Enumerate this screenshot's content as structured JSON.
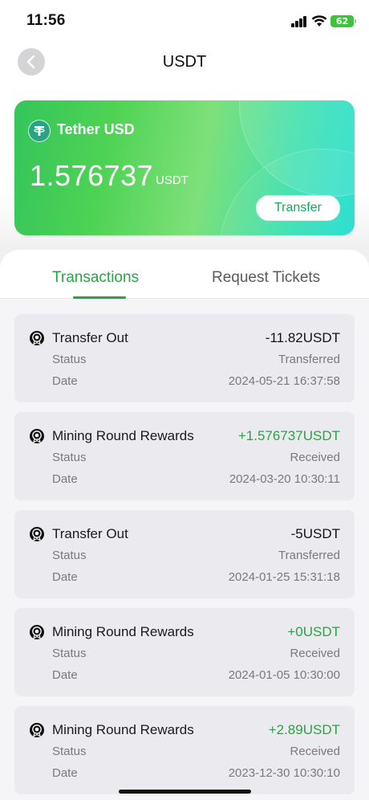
{
  "status_bar": {
    "time": "11:56",
    "battery": "62"
  },
  "header": {
    "title": "USDT"
  },
  "card": {
    "name": "Tether USD",
    "balance": "1.576737",
    "unit": "USDT",
    "transfer_label": "Transfer"
  },
  "tabs": {
    "transactions": "Transactions",
    "request_tickets": "Request Tickets"
  },
  "transactions": [
    {
      "title": "Transfer Out",
      "amount": "-11.82USDT",
      "type": "negative",
      "status_label": "Status",
      "status": "Transferred",
      "date_label": "Date",
      "date": "2024-05-21 16:37:58"
    },
    {
      "title": "Mining Round Rewards",
      "amount": "+1.576737USDT",
      "type": "positive",
      "status_label": "Status",
      "status": "Received",
      "date_label": "Date",
      "date": "2024-03-20 10:30:11"
    },
    {
      "title": "Transfer Out",
      "amount": "-5USDT",
      "type": "negative",
      "status_label": "Status",
      "status": "Transferred",
      "date_label": "Date",
      "date": "2024-01-25 15:31:18"
    },
    {
      "title": "Mining Round Rewards",
      "amount": "+0USDT",
      "type": "positive",
      "status_label": "Status",
      "status": "Received",
      "date_label": "Date",
      "date": "2024-01-05 10:30:00"
    },
    {
      "title": "Mining Round Rewards",
      "amount": "+2.89USDT",
      "type": "positive",
      "status_label": "Status",
      "status": "Received",
      "date_label": "Date",
      "date": "2023-12-30 10:30:10"
    }
  ],
  "colors": {
    "accent": "#26a541",
    "card_start": "#34c55a",
    "card_end": "#22ded0"
  }
}
